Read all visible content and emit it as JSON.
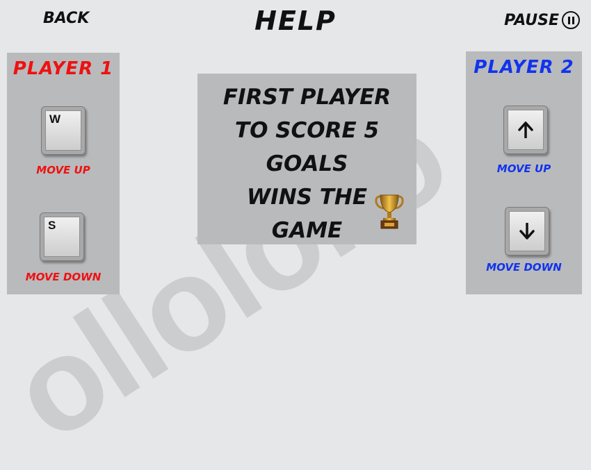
{
  "header": {
    "back_label": "BACK",
    "title": "HELP",
    "pause_label": "PAUSE"
  },
  "player1": {
    "label": "PLAYER 1",
    "color": "#ee1111",
    "up_key": "W",
    "up_action": "MOVE UP",
    "down_key": "S",
    "down_action": "MOVE DOWN"
  },
  "player2": {
    "label": "PLAYER 2",
    "color": "#1133ee",
    "up_key_icon": "arrow-up-icon",
    "up_action": "MOVE UP",
    "down_key_icon": "arrow-down-icon",
    "down_action": "MOVE DOWN"
  },
  "rules": {
    "lines": [
      "FIRST PLAYER",
      "TO SCORE 5",
      "GOALS",
      "WINS THE",
      "GAME"
    ],
    "icon": "trophy-icon"
  },
  "watermark": "ollolollo"
}
